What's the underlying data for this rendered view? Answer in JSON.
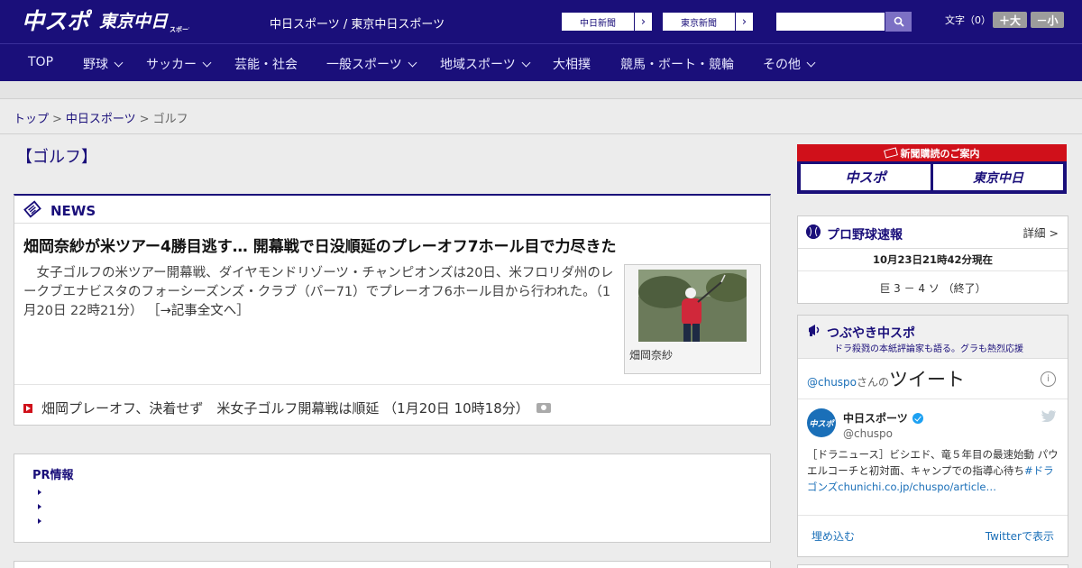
{
  "header": {
    "logo_chuspo": "中スポ",
    "logo_tokyo": "東京中日",
    "logo_tokyo_sub": "スポーツ",
    "site_title": "中日スポーツ / 東京中日スポーツ",
    "btn_chunichi": "中日新聞",
    "btn_tokyo": "東京新聞",
    "font_label": "文字（0）",
    "font_bigger": "＋大",
    "font_smaller": "－小",
    "arrow": "›",
    "search_icon": "search-icon"
  },
  "nav": {
    "items": [
      {
        "label": "TOP"
      },
      {
        "label": "野球"
      },
      {
        "label": "サッカー"
      },
      {
        "label": "芸能・社会"
      },
      {
        "label": "一般スポーツ"
      },
      {
        "label": "地域スポーツ"
      },
      {
        "label": "大相撲"
      },
      {
        "label": "競馬・ボート・競輪"
      },
      {
        "label": "その他"
      }
    ]
  },
  "breadcrumb": {
    "top": "トップ",
    "sep": ">",
    "chunichi": "中日スポーツ",
    "current": "ゴルフ"
  },
  "section_title": "【ゴルフ】",
  "news": {
    "label": "NEWS",
    "headline": "畑岡奈紗が米ツアー4勝目逃す… 開幕戦で日没順延のプレーオフ7ホール目で力尽きた",
    "summary": "　女子ゴルフの米ツアー開幕戦、ダイヤモンドリゾーツ・チャンピオンズは20日、米フロリダ州のレークブエナビスタのフォーシーズンズ・クラブ（パー71）でプレーオフ6ホール目から行われた。（1月20日 22時21分）",
    "more": "［→記事全文へ］",
    "photo_caption": "畑岡奈紗",
    "related": "畑岡プレーオフ、決着せず　米女子ゴルフ開幕戦は順延 （1月20日 10時18分）"
  },
  "pr": {
    "title": "PR情報"
  },
  "sidebar": {
    "subscription_title": "新聞購読のご案内",
    "sub_chuspo": "中スポ",
    "sub_tokyo": "東京中日",
    "baseball": {
      "title": "プロ野球速報",
      "detail": "詳細 >",
      "time": "10月23日21時42分現在",
      "score": "巨 3 － 4 ソ （終了）"
    },
    "tweets": {
      "title": "つぶやき中スポ",
      "subtitle": "ドラ殺戮の本紙評論家も語る。グラも熱烈応援",
      "handle": "@chuspo",
      "handle_suffix": "さんの",
      "tweet_word": "ツイート",
      "info": "i",
      "account_name": "中日スポーツ",
      "account_user": "@chuspo",
      "avatar_text": "中スポ",
      "tweet_text": "［ドラニュース］ビシエド、竜５年目の最速始動 パウエルコーチと初対面、キャンプでの指導心待ち",
      "tweet_link": "#ドラゴンズchunichi.co.jp/chuspo/article…",
      "embed": "埋め込む",
      "view": "Twitterで表示"
    }
  }
}
